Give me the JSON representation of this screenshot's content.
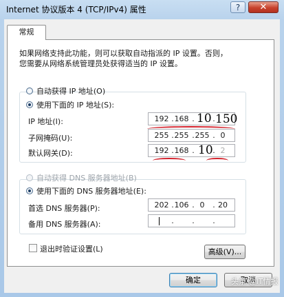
{
  "window": {
    "title": "Internet 协议版本 4 (TCP/IPv4) 属性",
    "help_glyph": "?",
    "close_glyph": "✕"
  },
  "tabs": [
    {
      "label": "常规"
    }
  ],
  "description": {
    "line1": "如果网络支持此功能，则可以获取自动指派的 IP 设置。否则，",
    "line2": "您需要从网络系统管理员处获得适当的 IP 设置。"
  },
  "ip_section": {
    "auto_label": "自动获得 IP 地址(O)",
    "manual_label": "使用下面的 IP 地址(S):",
    "selected": "manual",
    "fields": [
      {
        "label": "IP 地址(I):",
        "octets": [
          "192",
          "168",
          "10",
          "150"
        ]
      },
      {
        "label": "子网掩码(U):",
        "octets": [
          "255",
          "255",
          "255",
          "0"
        ]
      },
      {
        "label": "默认网关(D):",
        "octets": [
          "192",
          "168",
          "10",
          "2"
        ]
      }
    ]
  },
  "dns_section": {
    "auto_label": "自动获得 DNS 服务器地址(B)",
    "manual_label": "使用下面的 DNS 服务器地址(E):",
    "selected": "manual",
    "fields": [
      {
        "label": "首选 DNS 服务器(P):",
        "octets": [
          "202",
          "106",
          "0",
          "20"
        ]
      },
      {
        "label": "备用 DNS 服务器(A):",
        "octets": [
          "",
          "",
          "",
          ""
        ]
      }
    ]
  },
  "validate_on_exit": {
    "label": "退出时验证设置(L)",
    "checked": false
  },
  "buttons": {
    "advanced": "高级(V)...",
    "ok": "确定",
    "cancel": "取消"
  },
  "watermark": "头条 @IT情报",
  "colors": {
    "annotation_red": "#d3202a",
    "close_red": "#c8422d"
  }
}
